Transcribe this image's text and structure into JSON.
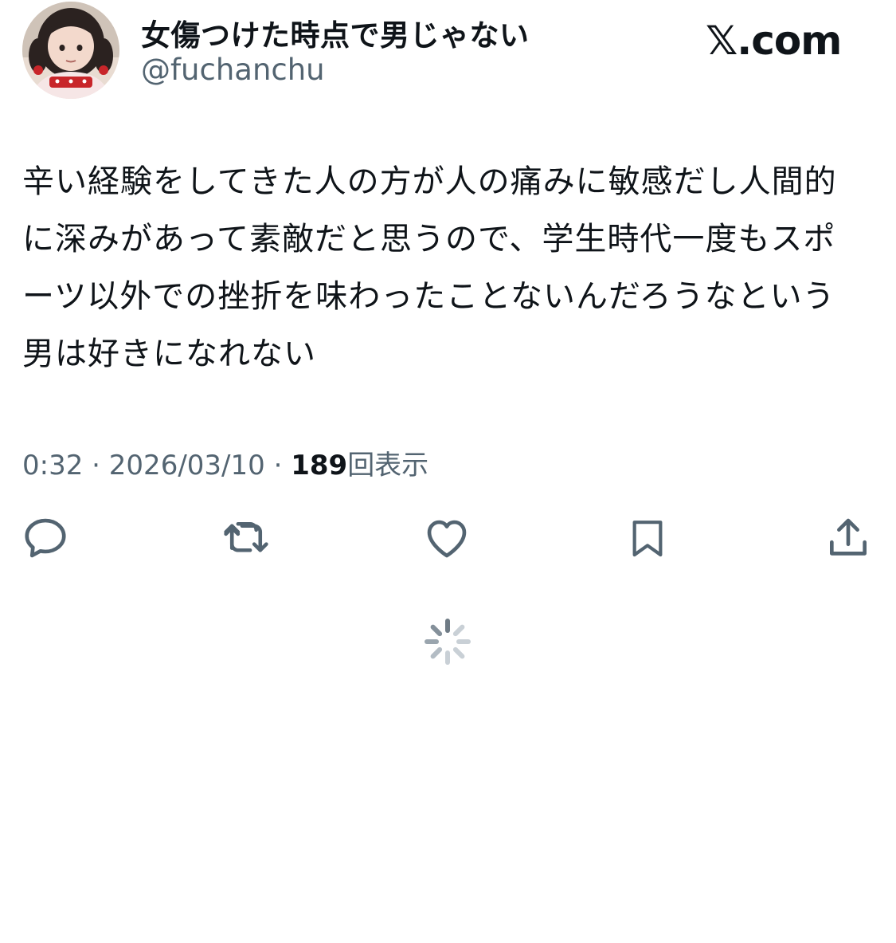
{
  "author": {
    "display_name": "女傷つけた時点で男じゃない",
    "handle": "@fuchanchu",
    "avatar_icon": "user-avatar-photo"
  },
  "brand": {
    "label": "𝕏.com"
  },
  "tweet": {
    "text": "辛い経験をしてきた人の方が人の痛みに敏感だし人間的に深みがあって素敵だと思うので、学生時代一度もスポーツ以外での挫折を味わったことないんだろうなという男は好きになれない",
    "time": "0:32",
    "separator": "·",
    "date": "2026/03/10",
    "views_count": "189",
    "views_label": "回表示"
  },
  "actions": [
    {
      "name": "reply",
      "icon": "reply-icon"
    },
    {
      "name": "retweet",
      "icon": "retweet-icon"
    },
    {
      "name": "like",
      "icon": "heart-icon"
    },
    {
      "name": "bookmark",
      "icon": "bookmark-icon"
    },
    {
      "name": "share",
      "icon": "share-icon"
    }
  ],
  "loading": {
    "icon": "loading-spinner-icon"
  },
  "colors": {
    "text_primary": "#0f1419",
    "text_secondary": "#536471",
    "icon": "#536471",
    "background": "#ffffff"
  }
}
